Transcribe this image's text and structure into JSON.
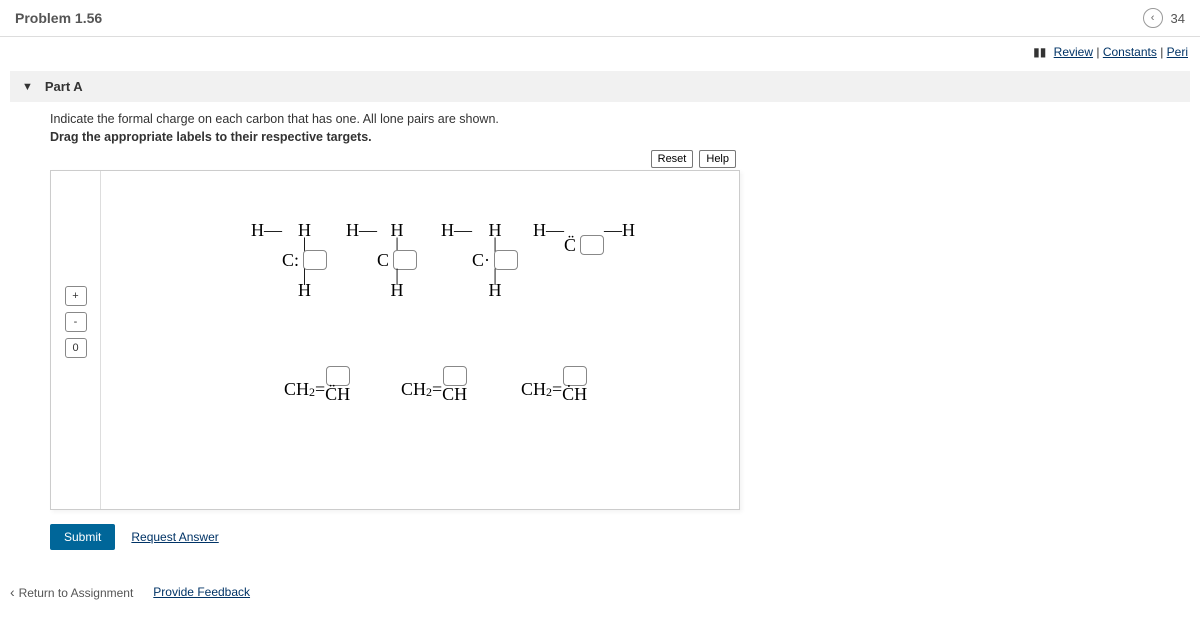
{
  "header": {
    "title": "Problem 1.56",
    "problem_num": "34"
  },
  "toplinks": {
    "review": "Review",
    "constants": "Constants",
    "periodic": "Peri"
  },
  "part": {
    "label": "Part A"
  },
  "instructions": {
    "line1": "Indicate the formal charge on each carbon that has one. All lone pairs are shown.",
    "line2": "Drag the appropriate labels to their respective targets."
  },
  "buttons": {
    "reset": "Reset",
    "help": "Help",
    "submit": "Submit",
    "request": "Request Answer",
    "return": "Return to Assignment",
    "feedback": "Provide Feedback"
  },
  "palette": {
    "plus": "+",
    "minus": "-",
    "zero": "0"
  },
  "atoms": {
    "H": "H",
    "C_lp": "C:",
    "C": "C",
    "C_1dot": "C·",
    "Cdd": "C̈",
    "bond": "—",
    "vbar": "|"
  },
  "ch2": {
    "ch2": "CH",
    "sub2": "2",
    "eq": "=",
    "CH_dd": "C̈H",
    "CH": "CH",
    "CH_dot": "ĊH"
  }
}
